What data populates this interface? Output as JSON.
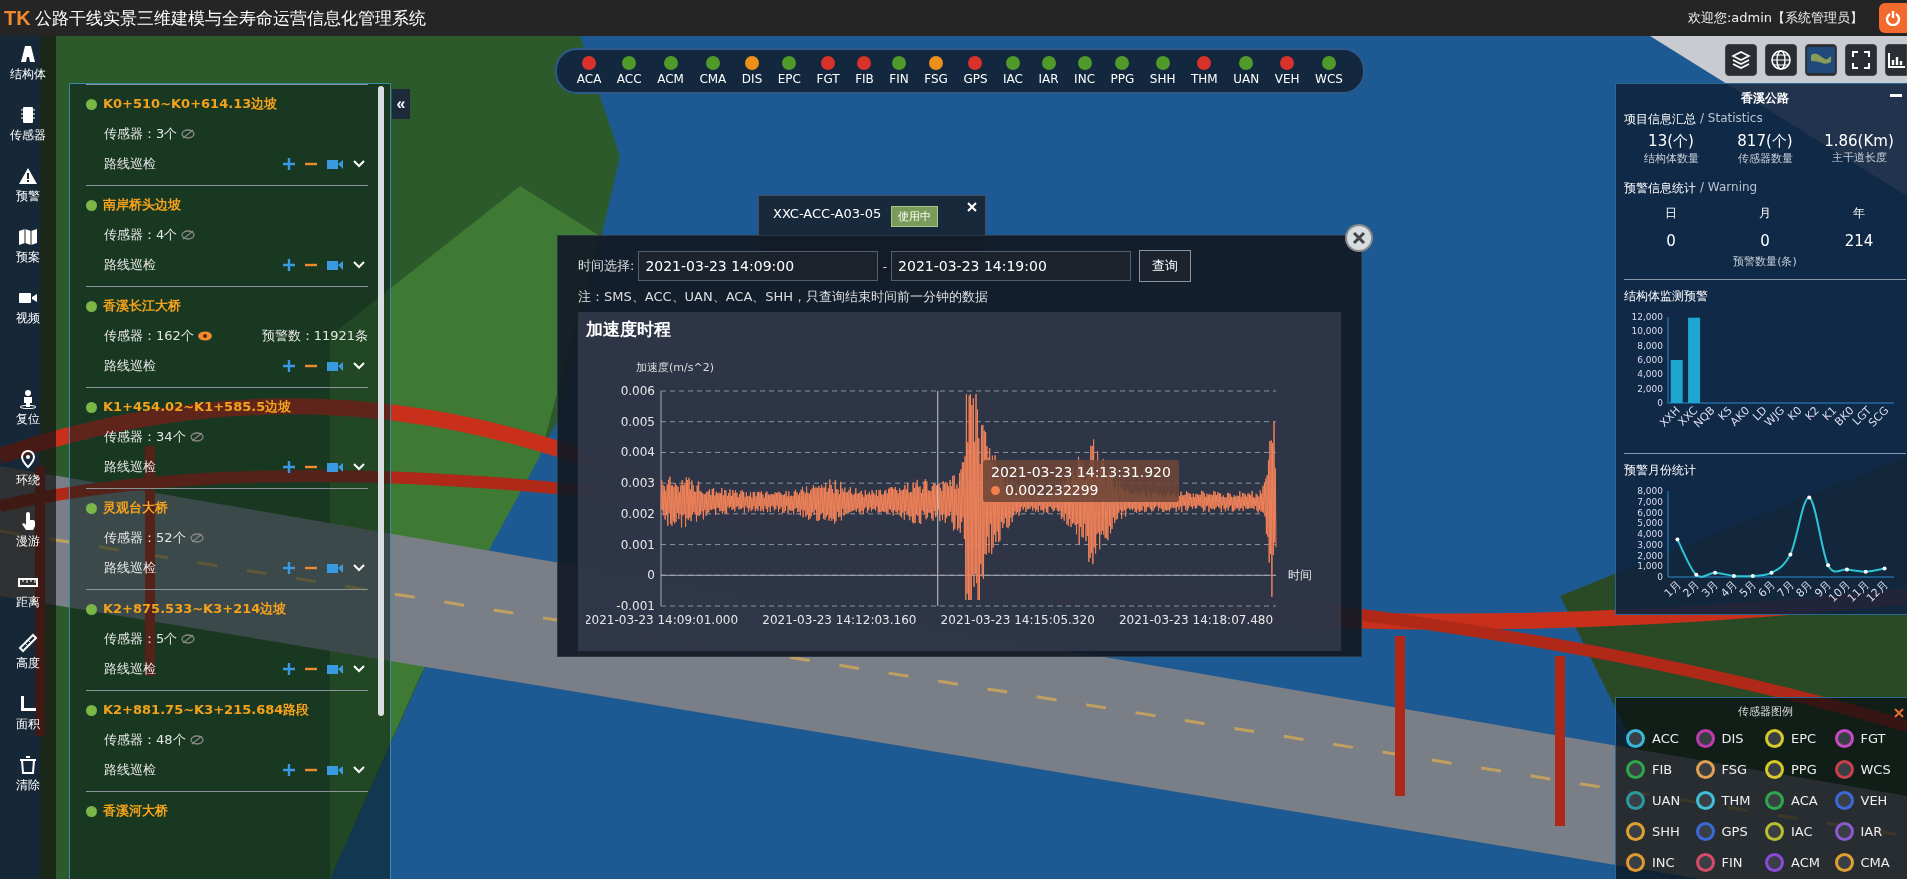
{
  "header": {
    "logo": "TK",
    "title": "公路干线实景三维建模与全寿命运营信息化管理系统",
    "welcome": "欢迎您:admin【系统管理员】"
  },
  "toolbar": [
    {
      "label": "结构体"
    },
    {
      "label": "传感器"
    },
    {
      "label": "预警"
    },
    {
      "label": "预案"
    },
    {
      "label": "视频"
    },
    {
      "label": "复位"
    },
    {
      "label": "环绕"
    },
    {
      "label": "漫游"
    },
    {
      "label": "距离"
    },
    {
      "label": "高度"
    },
    {
      "label": "面积"
    },
    {
      "label": "清除"
    }
  ],
  "project_list": {
    "collapse": "«",
    "items": [
      {
        "name": "K0+510~K0+614.13边坡",
        "sensors": "传感器：3个",
        "sensors_visible": false,
        "patrol": "路线巡检"
      },
      {
        "name": "南岸桥头边坡",
        "sensors": "传感器：4个",
        "sensors_visible": false,
        "patrol": "路线巡检"
      },
      {
        "name": "香溪长江大桥",
        "sensors": "传感器：162个",
        "sensors_visible": true,
        "warnings": "预警数：11921条",
        "patrol": "路线巡检"
      },
      {
        "name": "K1+454.02~K1+585.5边坡",
        "sensors": "传感器：34个",
        "sensors_visible": false,
        "patrol": "路线巡检"
      },
      {
        "name": "灵观台大桥",
        "sensors": "传感器：52个",
        "sensors_visible": false,
        "patrol": "路线巡检"
      },
      {
        "name": "K2+875.533~K3+214边坡",
        "sensors": "传感器：5个",
        "sensors_visible": false,
        "patrol": "路线巡检"
      },
      {
        "name": "K2+881.75~K3+215.684路段",
        "sensors": "传感器：48个",
        "sensors_visible": false,
        "patrol": "路线巡检"
      },
      {
        "name": "香溪河大桥"
      }
    ]
  },
  "status_strip": [
    {
      "code": "ACA",
      "color": "#d9322a"
    },
    {
      "code": "ACC",
      "color": "#4f9a2a"
    },
    {
      "code": "ACM",
      "color": "#4f9a2a"
    },
    {
      "code": "CMA",
      "color": "#4f9a2a"
    },
    {
      "code": "DIS",
      "color": "#f0901c"
    },
    {
      "code": "EPC",
      "color": "#4f9a2a"
    },
    {
      "code": "FGT",
      "color": "#d9322a"
    },
    {
      "code": "FIB",
      "color": "#d9322a"
    },
    {
      "code": "FIN",
      "color": "#4f9a2a"
    },
    {
      "code": "FSG",
      "color": "#f0901c"
    },
    {
      "code": "GPS",
      "color": "#d9322a"
    },
    {
      "code": "IAC",
      "color": "#4f9a2a"
    },
    {
      "code": "IAR",
      "color": "#4f9a2a"
    },
    {
      "code": "INC",
      "color": "#4f9a2a"
    },
    {
      "code": "PPG",
      "color": "#4f9a2a"
    },
    {
      "code": "SHH",
      "color": "#4f9a2a"
    },
    {
      "code": "THM",
      "color": "#d9322a"
    },
    {
      "code": "UAN",
      "color": "#4f9a2a"
    },
    {
      "code": "VEH",
      "color": "#d9322a"
    },
    {
      "code": "WCS",
      "color": "#4f9a2a"
    }
  ],
  "sensor_popup": {
    "title": "XXC-ACC-A03-05",
    "status": "使用中"
  },
  "chart_dialog": {
    "time_label": "时间选择:",
    "start": "2021-03-23 14:09:00",
    "separator": "-",
    "end": "2021-03-23 14:19:00",
    "query": "查询",
    "note": "注：SMS、ACC、UAN、ACA、SHH，只查询结束时间前一分钟的数据",
    "chart_title": "加速度时程",
    "y_axis_label": "加速度(m/s^2)",
    "x_axis_label": "时间",
    "y_tick_labels": [
      "0.006",
      "0.005",
      "0.004",
      "0.003",
      "0.002",
      "0.001",
      "0",
      "-0.001"
    ],
    "x_tick_labels": [
      "2021-03-23 14:09:01.000",
      "2021-03-23 14:12:03.160",
      "2021-03-23 14:15:05.320",
      "2021-03-23 14:18:07.480"
    ],
    "tooltip": {
      "time": "2021-03-23 14:13:31.920",
      "value": "0.002232299"
    }
  },
  "right_panel": {
    "title": "香溪公路",
    "statistics": {
      "title": "项目信息汇总",
      "subtitle": "/ Statistics",
      "items": [
        {
          "value": "13(个)",
          "label": "结构体数量"
        },
        {
          "value": "817(个)",
          "label": "传感器数量"
        },
        {
          "value": "1.86(Km)",
          "label": "主干道长度"
        }
      ]
    },
    "warning": {
      "title": "预警信息统计",
      "subtitle": "/ Warning",
      "items": [
        {
          "label": "日",
          "value": "0"
        },
        {
          "label": "月",
          "value": "0"
        },
        {
          "label": "年",
          "value": "214"
        }
      ],
      "caption": "预警数量(条)"
    },
    "structure_warning": {
      "title": "结构体监测预警",
      "chart_data": {
        "type": "bar",
        "categories": [
          "XXH",
          "XXC",
          "NQB",
          "K5",
          "AK0",
          "LD",
          "WJG",
          "K0",
          "K2",
          "K1",
          "BK0",
          "LGT",
          "SCG"
        ],
        "series": [
          {
            "color": "#1fa6d0",
            "values": [
              6000,
              11900,
              0,
              0,
              0,
              0,
              0,
              0,
              0,
              0,
              0,
              0,
              0
            ]
          }
        ],
        "ylim": [
          0,
          12000
        ],
        "yticks": [
          {
            "value": 0,
            "label": "0"
          },
          {
            "value": 2000,
            "label": "2,000"
          },
          {
            "value": 4000,
            "label": "4,000"
          },
          {
            "value": 6000,
            "label": "6,000"
          },
          {
            "value": 8000,
            "label": "8,000"
          },
          {
            "value": 10000,
            "label": "10,000"
          },
          {
            "value": 12000,
            "label": "12,000"
          }
        ]
      }
    },
    "monthly_warning": {
      "title": "预警月份统计",
      "chart_data": {
        "type": "line",
        "categories": [
          "1月",
          "2月",
          "3月",
          "4月",
          "5月",
          "6月",
          "7月",
          "8月",
          "9月",
          "10月",
          "11月",
          "12月"
        ],
        "series": [
          {
            "color": "#2ec4d6",
            "values": [
              3500,
              200,
              400,
              100,
              100,
              400,
              2100,
              7400,
              1100,
              700,
              500,
              800
            ]
          }
        ],
        "ylim": [
          0,
          8000
        ],
        "yticks": [
          {
            "value": 0,
            "label": "0"
          },
          {
            "value": 1000,
            "label": "1,000"
          },
          {
            "value": 2000,
            "label": "2,000"
          },
          {
            "value": 3000,
            "label": "3,000"
          },
          {
            "value": 4000,
            "label": "4,000"
          },
          {
            "value": 5000,
            "label": "5,000"
          },
          {
            "value": 6000,
            "label": "6,000"
          },
          {
            "value": 7000,
            "label": "7,000"
          },
          {
            "value": 8000,
            "label": "8,000"
          }
        ]
      }
    }
  },
  "legend": {
    "title": "传感器图例",
    "items": [
      {
        "code": "ACC",
        "color": "#39b8d8"
      },
      {
        "code": "DIS",
        "color": "#c03ab0"
      },
      {
        "code": "EPC",
        "color": "#d8c82a"
      },
      {
        "code": "FGT",
        "color": "#c84ac8"
      },
      {
        "code": "FIB",
        "color": "#2ea84a"
      },
      {
        "code": "FSG",
        "color": "#e0a050"
      },
      {
        "code": "PPG",
        "color": "#d8c82a"
      },
      {
        "code": "WCS",
        "color": "#c8404a"
      },
      {
        "code": "UAN",
        "color": "#2a9aa0"
      },
      {
        "code": "THM",
        "color": "#40c0d8"
      },
      {
        "code": "ACA",
        "color": "#2ea84a"
      },
      {
        "code": "VEH",
        "color": "#3a6ad8"
      },
      {
        "code": "SHH",
        "color": "#e0a030"
      },
      {
        "code": "GPS",
        "color": "#3a6ad8"
      },
      {
        "code": "IAC",
        "color": "#b8c030"
      },
      {
        "code": "IAR",
        "color": "#8a5ad0"
      },
      {
        "code": "INC",
        "color": "#e09a30"
      },
      {
        "code": "FIN",
        "color": "#d84a6a"
      },
      {
        "code": "ACM",
        "color": "#8a4ad8"
      },
      {
        "code": "CMA",
        "color": "#e0a030"
      }
    ]
  }
}
